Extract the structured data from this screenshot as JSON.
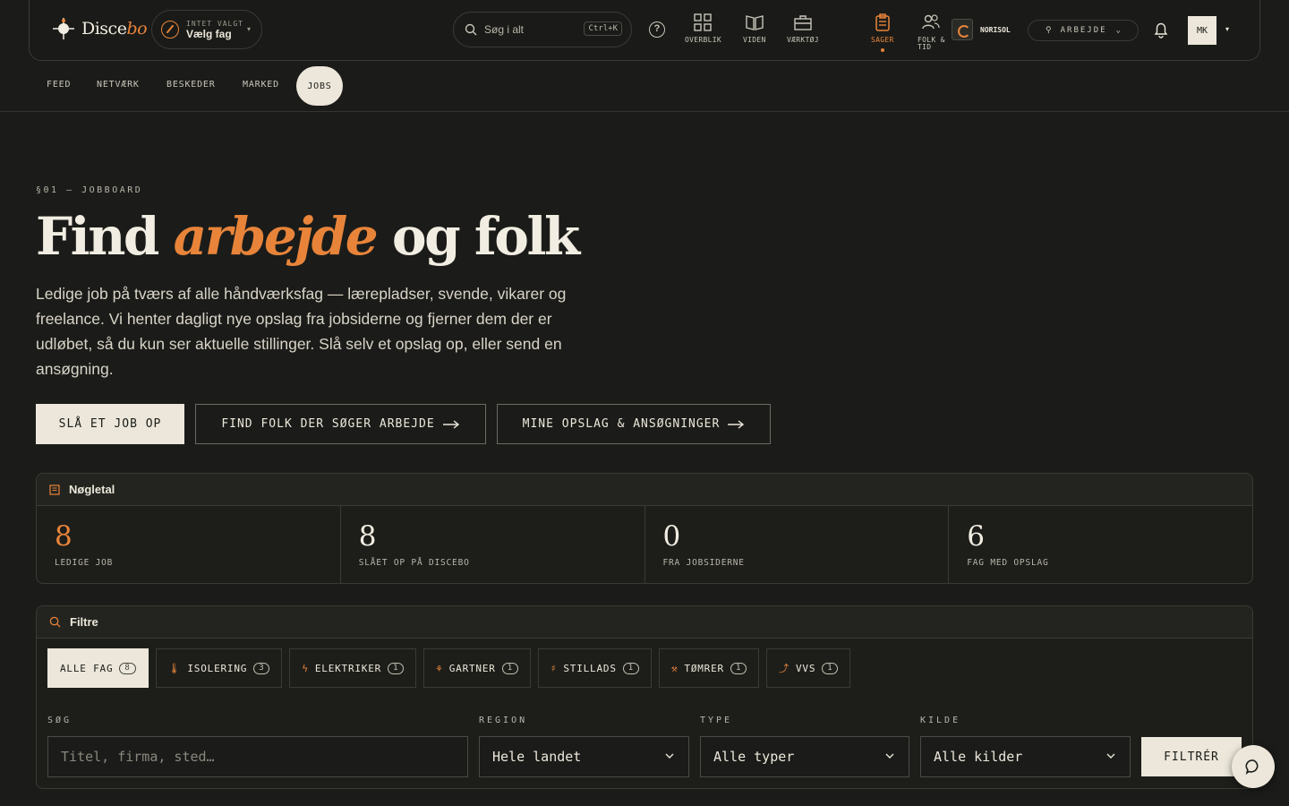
{
  "brand": {
    "name_plain": "Disce",
    "name_accent": "bo"
  },
  "trade": {
    "status": "INTET VALGT",
    "label": "Vælg fag"
  },
  "search": {
    "placeholder": "Søg i alt",
    "shortcut": "Ctrl+K"
  },
  "nav": [
    {
      "label": "OVERBLIK",
      "icon": "grid-icon",
      "active": false
    },
    {
      "label": "VIDEN",
      "icon": "book-icon",
      "active": false
    },
    {
      "label": "VÆRKTØJ",
      "icon": "toolbox-icon",
      "active": false
    },
    {
      "label": "SAGER",
      "icon": "clipboard-icon",
      "active": true
    },
    {
      "label_line1": "FOLK &",
      "label_line2": "TID",
      "icon": "people-icon",
      "active": false
    }
  ],
  "org": {
    "name": "NORISOL"
  },
  "work_mode": {
    "label": "ARBEJDE"
  },
  "user": {
    "initials": "MK"
  },
  "subnav": [
    {
      "label": "FEED"
    },
    {
      "label": "NETVÆRK"
    },
    {
      "label": "BESKEDER"
    },
    {
      "label": "MARKED"
    },
    {
      "label": "JOBS",
      "active": true
    }
  ],
  "hero": {
    "eyebrow": "§01 — JOBBOARD",
    "title_a": "Find",
    "title_accent": "arbejde",
    "title_b": "og folk",
    "lead": "Ledige job på tværs af alle håndværksfag — lærepladser, svende, vikarer og freelance. Vi henter dagligt nye opslag fra jobsiderne og fjerner dem der er udløbet, så du kun ser aktuelle stillinger. Slå selv et opslag op, eller send en ansøgning.",
    "btn_post": "SLÅ ET JOB OP",
    "btn_find": "FIND FOLK DER SØGER ARBEJDE",
    "btn_mine": "MINE OPSLAG & ANSØGNINGER"
  },
  "kpis": {
    "title": "Nøgletal",
    "items": [
      {
        "value": "8",
        "label": "LEDIGE JOB"
      },
      {
        "value": "8",
        "label": "SLÅET OP PÅ DISCEBO"
      },
      {
        "value": "0",
        "label": "FRA JOBSIDERNE"
      },
      {
        "value": "6",
        "label": "FAG MED OPSLAG"
      }
    ]
  },
  "filters": {
    "title": "Filtre",
    "chips": [
      {
        "label": "ALLE FAG",
        "count": "8",
        "active": true
      },
      {
        "label": "ISOLERING",
        "count": "3"
      },
      {
        "label": "ELEKTRIKER",
        "count": "1"
      },
      {
        "label": "GARTNER",
        "count": "1"
      },
      {
        "label": "STILLADS",
        "count": "1"
      },
      {
        "label": "TØMRER",
        "count": "1"
      },
      {
        "label": "VVS",
        "count": "1"
      }
    ],
    "search_label": "SØG",
    "search_placeholder": "Titel, firma, sted…",
    "region_label": "REGION",
    "region_value": "Hele landet",
    "type_label": "TYPE",
    "type_value": "Alle typer",
    "source_label": "KILDE",
    "source_value": "Alle kilder",
    "apply": "FILTRÉR"
  },
  "colors": {
    "accent": "#e8843a",
    "bg": "#1b1c19",
    "cream": "#ece7da"
  }
}
